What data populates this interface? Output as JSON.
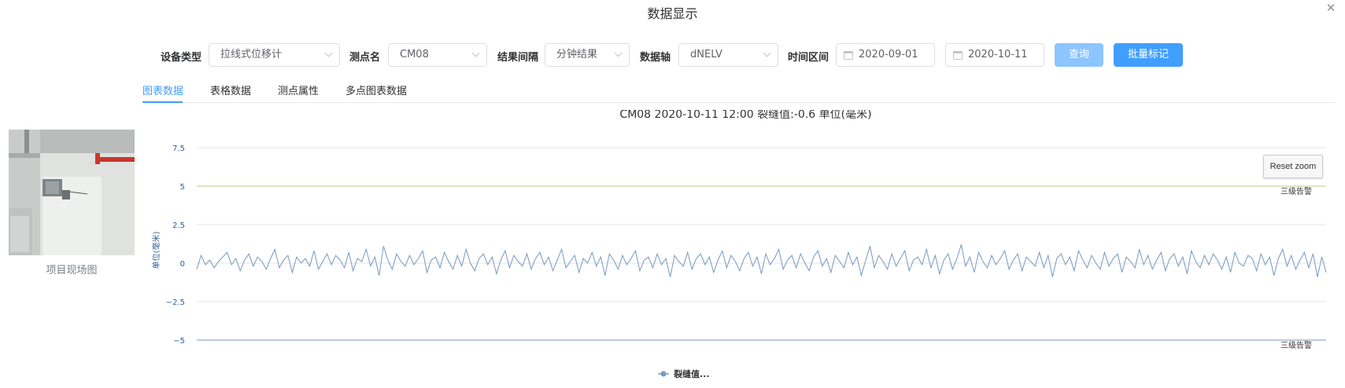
{
  "dialog": {
    "title": "数据显示",
    "close_icon": "close-icon"
  },
  "toolbar": {
    "device_type_label": "设备类型",
    "device_type_value": "拉线式位移计",
    "point_label": "测点名",
    "point_value": "CM08",
    "interval_label": "结果间隔",
    "interval_value": "分钟结果",
    "axis_label": "数据轴",
    "axis_value": "dNELV",
    "time_range_label": "时间区间",
    "start_date": "2020-09-01",
    "end_date": "2020-10-11",
    "query_button": "查询",
    "batch_mark_button": "批量标记",
    "colors": {
      "primary": "#409eff",
      "primary_light": "#8cc5ff"
    }
  },
  "tabs": [
    {
      "label": "图表数据",
      "active": true
    },
    {
      "label": "表格数据",
      "active": false
    },
    {
      "label": "测点属性",
      "active": false
    },
    {
      "label": "多点图表数据",
      "active": false
    }
  ],
  "site": {
    "caption": "项目现场图"
  },
  "chart": {
    "reset_zoom": "Reset zoom"
  },
  "chart_data": {
    "type": "line",
    "title": "CM08 2020-10-11 12:00 裂缝值:-0.6 单位(毫米)",
    "ylabel": "单位(毫米)",
    "xlabel": "",
    "ylim": [
      -5,
      7.5
    ],
    "yticks": [
      "7.5",
      "5",
      "2.5",
      "0",
      "−2.5",
      "−5"
    ],
    "grid": true,
    "legend_position": "bottom-center",
    "series": [
      {
        "name": "裂缝值...",
        "color": "#7798bf",
        "values": [
          -0.4,
          0.5,
          -0.1,
          0.2,
          -0.3,
          0.1,
          0.4,
          0.7,
          -0.1,
          0.3,
          -0.5,
          0.2,
          0.6,
          -0.2,
          0.4,
          0.1,
          -0.4,
          0.3,
          0.9,
          -0.3,
          0.2,
          0.5,
          -0.6,
          0.4,
          0.0,
          0.3,
          -0.2,
          0.8,
          -0.4,
          0.1,
          0.6,
          -0.1,
          0.5,
          0.2,
          -0.3,
          0.7,
          -0.5,
          0.3,
          0.1,
          0.9,
          -0.2,
          0.4,
          -0.8,
          1.1,
          0.2,
          -0.4,
          0.6,
          0.1,
          -0.2,
          0.5,
          -0.1,
          0.3,
          0.8,
          -0.6,
          0.2,
          0.4,
          -0.3,
          0.7,
          0.1,
          -0.4,
          0.5,
          -0.2,
          0.9,
          0.0,
          -0.5,
          0.3,
          0.6,
          -0.1,
          0.4,
          -0.7,
          0.2,
          0.8,
          -0.3,
          0.5,
          0.1,
          -0.2,
          0.6,
          -0.4,
          0.3,
          0.7,
          -0.1,
          0.4,
          -0.5,
          0.2,
          0.9,
          -0.3,
          0.1,
          0.5,
          -0.6,
          0.3,
          0.0,
          0.7,
          -0.2,
          0.4,
          -0.8,
          0.6,
          0.2,
          -0.4,
          0.5,
          -0.1,
          0.3,
          0.8,
          -0.5,
          0.2,
          0.4,
          -0.3,
          0.6,
          -0.1,
          0.3,
          -0.9,
          0.5,
          0.1,
          -0.2,
          0.7,
          -0.4,
          0.3,
          0.6,
          -0.1,
          0.4,
          -0.6,
          0.2,
          0.8,
          -0.3,
          0.5,
          0.1,
          -0.5,
          0.3,
          0.7,
          -0.2,
          0.4,
          -0.7,
          0.6,
          -0.1,
          0.3,
          0.9,
          -0.4,
          0.2,
          0.5,
          -0.3,
          0.6,
          0.0,
          -0.5,
          0.4,
          0.8,
          -0.2,
          0.3,
          -0.6,
          0.5,
          0.1,
          -0.3,
          0.7,
          -0.1,
          0.4,
          -0.8,
          0.2,
          1.1,
          -0.3,
          0.5,
          0.1,
          -0.4,
          0.6,
          -0.2,
          0.3,
          0.8,
          -0.5,
          0.2,
          0.4,
          -0.1,
          0.9,
          -0.3,
          0.5,
          -0.7,
          0.2,
          0.6,
          -0.4,
          0.3,
          1.2,
          -0.2,
          0.4,
          -0.6,
          0.7,
          0.1,
          -0.3,
          0.5,
          -0.1,
          0.3,
          0.8,
          -0.4,
          0.2,
          0.6,
          -0.5,
          0.4,
          0.1,
          -0.2,
          0.7,
          -0.3,
          0.5,
          -0.9,
          0.3,
          0.6,
          -0.1,
          0.4,
          -0.5,
          0.8,
          0.2,
          -0.3,
          0.5,
          0.0,
          -0.4,
          0.7,
          -0.2,
          0.3,
          0.6,
          -0.6,
          0.4,
          0.1,
          -0.3,
          0.9,
          -0.1,
          0.5,
          -0.4,
          0.2,
          0.7,
          -0.5,
          0.3,
          0.6,
          -0.2,
          0.4,
          -0.7,
          0.8,
          0.1,
          -0.3,
          0.5,
          -0.1,
          0.6,
          0.2,
          -0.4,
          0.4,
          -0.6,
          0.7,
          0.0,
          -0.2,
          0.5,
          0.3,
          -0.5,
          0.6,
          -0.1,
          0.4,
          -0.8,
          0.3,
          0.9,
          -0.2,
          0.5,
          -0.4,
          0.2,
          0.7,
          -0.3,
          0.6,
          -0.9,
          0.4,
          -0.6
        ]
      }
    ],
    "plot_lines": [
      {
        "value": 5,
        "label": "三级告警",
        "color": "#d9d9b0"
      },
      {
        "value": -5,
        "label": "三级告警",
        "color": "#a8b8c8"
      }
    ]
  }
}
